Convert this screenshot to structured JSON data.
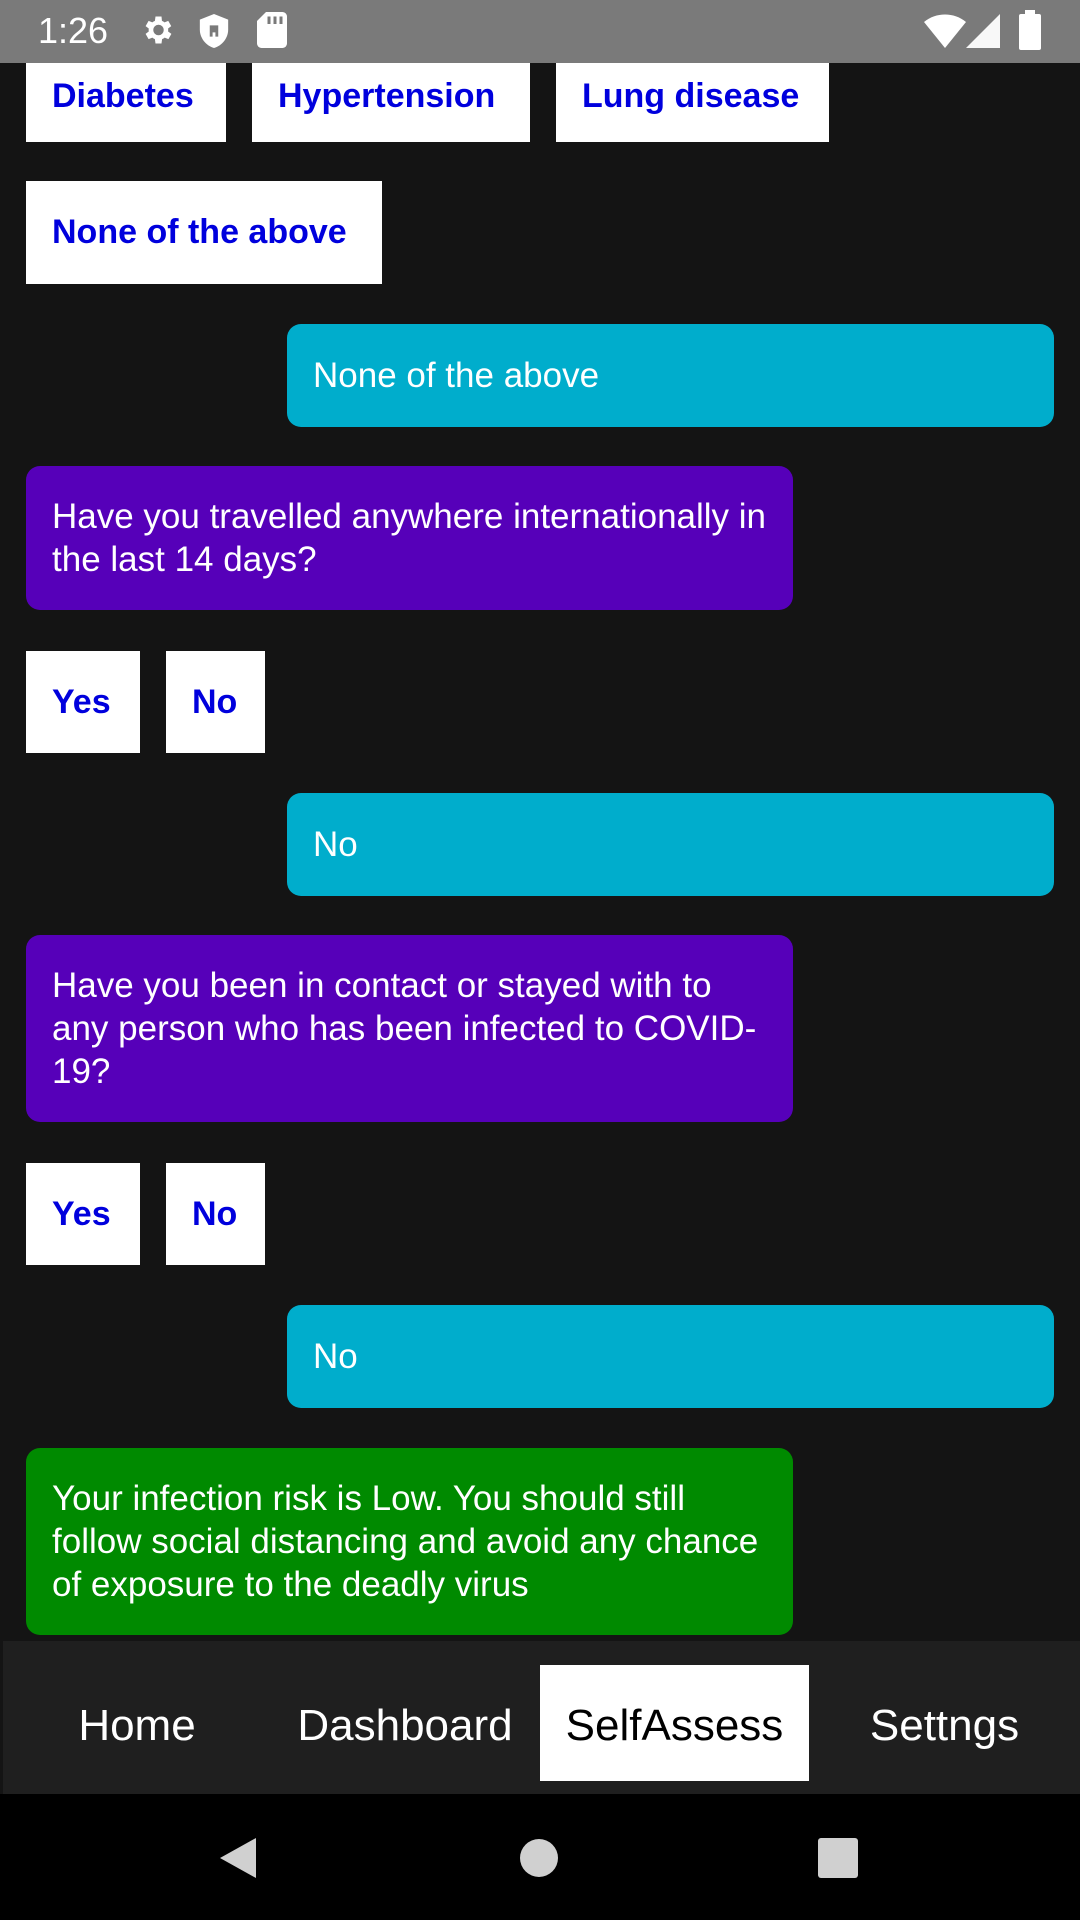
{
  "status": {
    "time": "1:26"
  },
  "chat": {
    "q_conditions_options": [
      "Diabetes",
      "Hypertension",
      "Lung disease",
      "None of the above"
    ],
    "answer_conditions": "None of the above",
    "q_travel": "Have you travelled anywhere internationally in the last 14 days?",
    "travel_options": [
      "Yes",
      "No"
    ],
    "answer_travel": "No",
    "q_contact": "Have you been in contact or stayed with to any person who has been infected to COVID-19?",
    "contact_options": [
      "Yes",
      "No"
    ],
    "answer_contact": "No",
    "result": "Your infection risk is Low. You should still follow social distancing and avoid any chance of exposure to the deadly virus"
  },
  "tabs": [
    "Home",
    "Dashboard",
    "SelfAssess",
    "Settngs"
  ],
  "active_tab": "SelfAssess",
  "colors": {
    "user_bubble": "#00adcc",
    "bot_bubble": "#5600b9",
    "result_bubble": "#008a00",
    "option_text": "#0000dd"
  },
  "icons": {
    "status": [
      "gear-icon",
      "shield-icon",
      "sd-card-icon",
      "wifi-icon",
      "signal-icon",
      "battery-icon"
    ],
    "nav": [
      "back-icon",
      "home-circle-icon",
      "recents-square-icon"
    ]
  }
}
